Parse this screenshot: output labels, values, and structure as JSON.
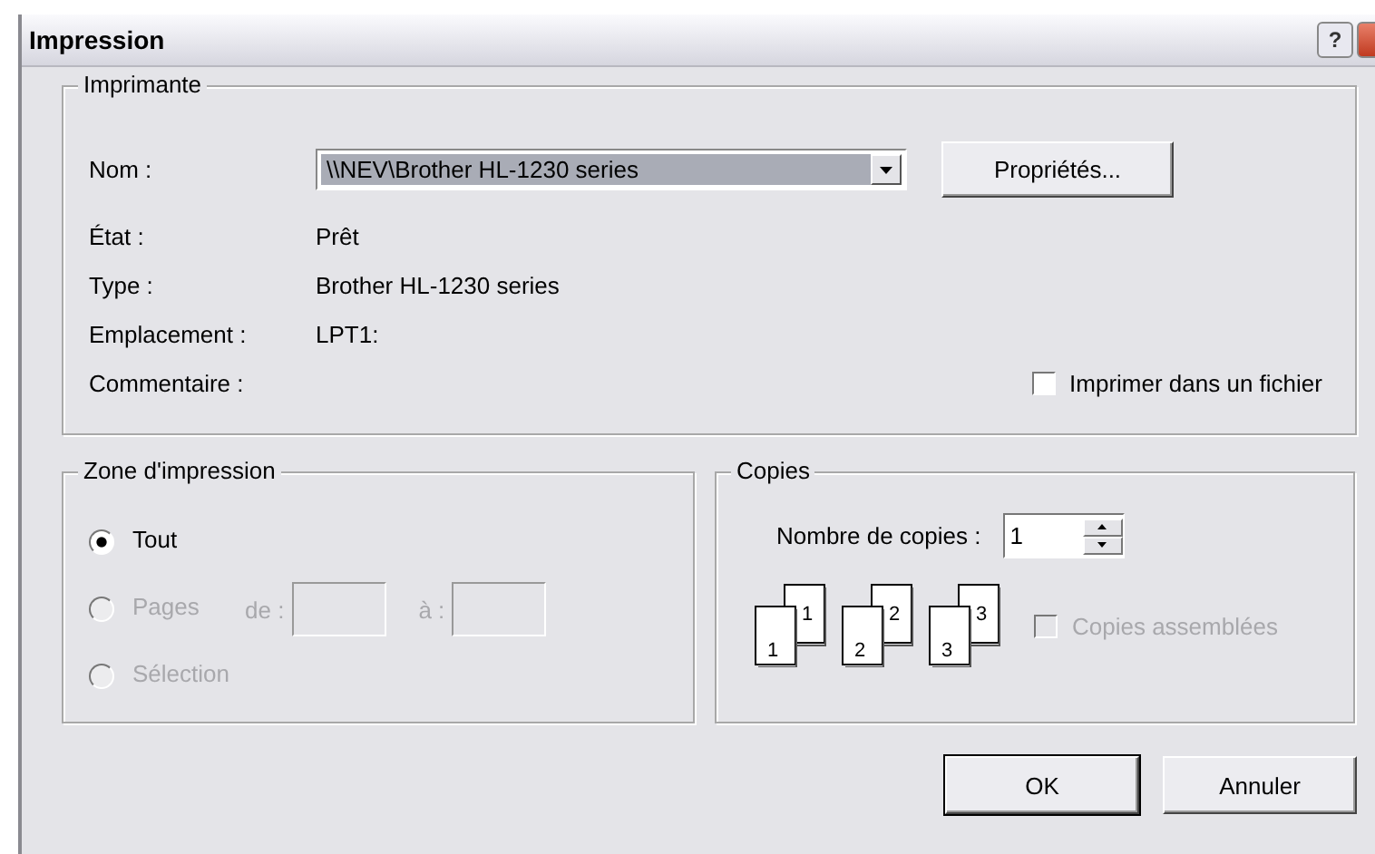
{
  "window": {
    "title": "Impression",
    "buttons": [
      {
        "kind": "help",
        "label": "?"
      },
      {
        "kind": "close"
      }
    ]
  },
  "printer": {
    "legend": "Imprimante",
    "name_label": "Nom :",
    "name_value": "\\\\NEV\\Brother HL-1230 series",
    "properties_button": "Propriétés...",
    "info": [
      {
        "label": "État :",
        "value": "Prêt"
      },
      {
        "label": "Type :",
        "value": "Brother HL-1230 series"
      },
      {
        "label": "Emplacement :",
        "value": "LPT1:"
      },
      {
        "label": "Commentaire :"
      }
    ],
    "print_to_file": {
      "label": "Imprimer dans un fichier",
      "checked": false,
      "disabled": false
    }
  },
  "print_range": {
    "legend": "Zone d'impression",
    "options": [
      {
        "label": "Tout",
        "selected": true,
        "disabled": false
      },
      {
        "label": "Pages",
        "selected": false,
        "disabled": true,
        "from_label": "de :",
        "to_label": "à :"
      },
      {
        "label": "Sélection",
        "selected": false,
        "disabled": true
      }
    ]
  },
  "copies": {
    "legend": "Copies",
    "count_label": "Nombre de copies :",
    "count_value": "1",
    "stacks": [
      {
        "front": "1",
        "back": "1"
      },
      {
        "front": "2",
        "back": "2"
      },
      {
        "front": "3",
        "back": "3"
      }
    ],
    "collate": {
      "label": "Copies assemblées",
      "checked": false,
      "disabled": true
    }
  },
  "buttons": [
    {
      "label": "OK",
      "default": true
    },
    {
      "label": "Annuler",
      "default": false
    }
  ]
}
